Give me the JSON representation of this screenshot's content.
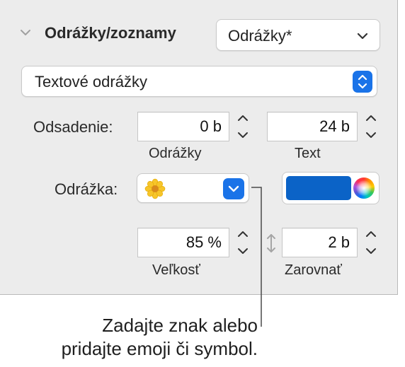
{
  "section": {
    "title": "Odrážky/zoznamy",
    "style_popup": "Odrážky*"
  },
  "bullet_type_popup": "Textové odrážky",
  "indent": {
    "label": "Odsadenie:",
    "bullet_value": "0 b",
    "bullet_sublabel": "Odrážky",
    "text_value": "24 b",
    "text_sublabel": "Text"
  },
  "bullet": {
    "label": "Odrážka:",
    "symbol_icon": "flower-emoji-icon",
    "color": "#0b63c7"
  },
  "size": {
    "value": "85 %",
    "sublabel": "Veľkosť"
  },
  "align": {
    "value": "2 b",
    "sublabel": "Zarovnať"
  },
  "callout": {
    "line1": "Zadajte znak alebo",
    "line2": "pridajte emoji či symbol."
  }
}
